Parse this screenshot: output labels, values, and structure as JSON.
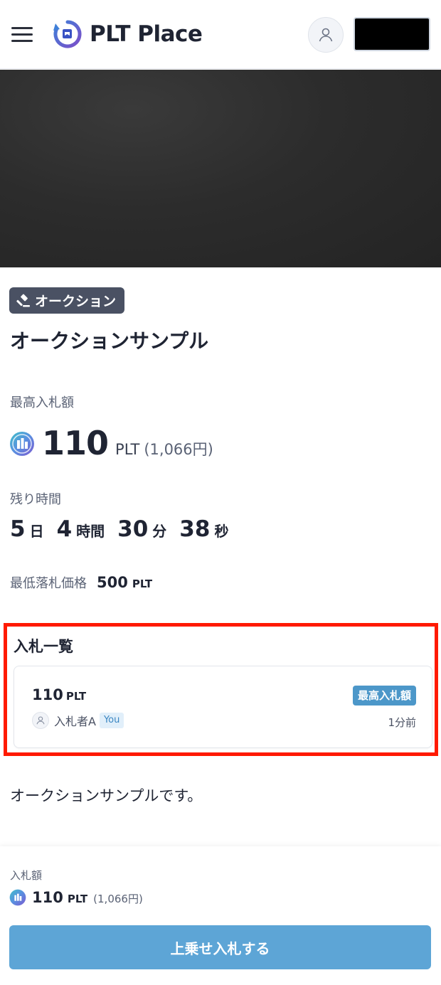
{
  "header": {
    "logo_text": "PLT Place",
    "menu_icon": "hamburger-menu-icon",
    "account_icon": "user-icon"
  },
  "item": {
    "category_badge": "オークション",
    "title": "オークションサンプル",
    "highest_bid_label": "最高入札額",
    "highest_bid_value": "110",
    "highest_bid_unit": "PLT",
    "highest_bid_jpy": "(1,066円)",
    "remaining_label": "残り時間",
    "remaining": {
      "days": "5",
      "days_unit": "日",
      "hours": "4",
      "hours_unit": "時間",
      "minutes": "30",
      "minutes_unit": "分",
      "seconds": "38",
      "seconds_unit": "秒"
    },
    "min_price_label": "最低落札価格",
    "min_price_value": "500",
    "min_price_unit": "PLT",
    "description": "オークションサンプルです。"
  },
  "bids": {
    "title": "入札一覧",
    "items": [
      {
        "amount": "110",
        "unit": "PLT",
        "badge": "最高入札額",
        "bidder": "入札者A",
        "you_tag": "You",
        "time": "1分前"
      }
    ]
  },
  "footer": {
    "bid_label": "入札額",
    "bid_value": "110",
    "bid_unit": "PLT",
    "bid_jpy": "(1,066円)",
    "button_label": "上乗せ入札する"
  },
  "colors": {
    "accent": "#5da5d6",
    "badge_dark": "#4a5163",
    "highlight_border": "#ff1a00",
    "top_bid_badge": "#4c97c9"
  }
}
